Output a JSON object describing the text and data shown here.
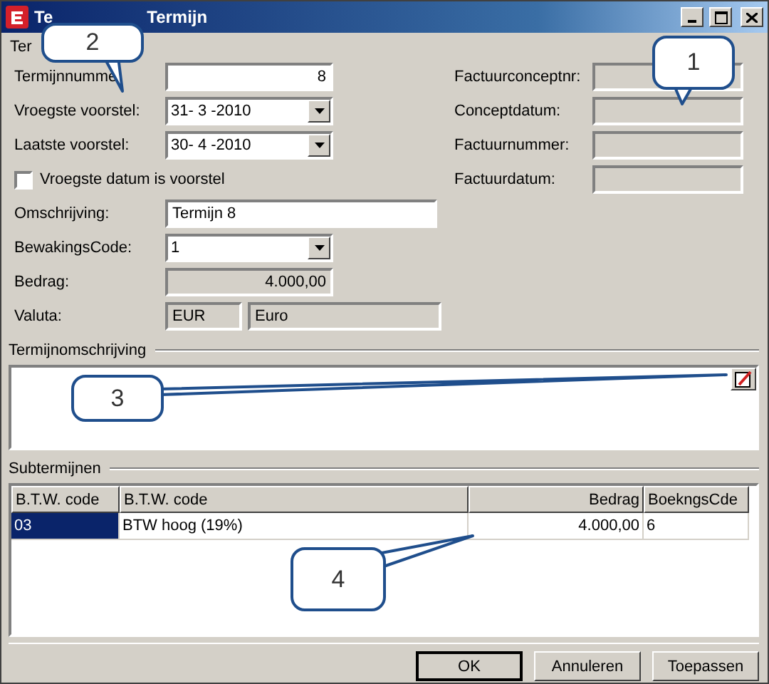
{
  "window": {
    "title_start": "Te",
    "title_end": "Termijn"
  },
  "group_label": "Ter",
  "left_fields": [
    {
      "label": "Termijnnumme",
      "kind": "number",
      "value": "8",
      "disabled": false
    },
    {
      "label": "Vroegste voorstel:",
      "kind": "combo",
      "value": "31- 3 -2010",
      "disabled": false
    },
    {
      "label": "Laatste voorstel:",
      "kind": "combo",
      "value": "30- 4 -2010",
      "disabled": false
    },
    {
      "label": "Vroegste datum is voorstel",
      "kind": "checkbox",
      "checked": false
    },
    {
      "label": "Omschrijving:",
      "kind": "wide",
      "value": "Termijn 8",
      "disabled": false
    },
    {
      "label": "BewakingsCode:",
      "kind": "combo",
      "value": "1",
      "disabled": false
    },
    {
      "label": "Bedrag:",
      "kind": "number",
      "value": "4.000,00",
      "disabled": true
    },
    {
      "label": "Valuta:",
      "kind": "pair",
      "value": "EUR",
      "value2": "Euro",
      "disabled": true
    }
  ],
  "right_fields": [
    {
      "label": "Factuurconceptnr:"
    },
    {
      "label": "Conceptdatum:"
    },
    {
      "label": "Factuurnummer:"
    },
    {
      "label": "Factuurdatum:"
    }
  ],
  "description_section": {
    "title": "Termijnomschrijving"
  },
  "subterms_section": {
    "title": "Subtermijnen",
    "table": {
      "columns": [
        "B.T.W. code",
        "B.T.W. code",
        "Bedrag",
        "BoekngsCde"
      ],
      "rows": [
        {
          "selected": true,
          "cells": [
            "03",
            "BTW hoog (19%)",
            "4.000,00",
            "6"
          ]
        }
      ]
    }
  },
  "buttons": [
    {
      "label": "OK",
      "default": true
    },
    {
      "label": "Annuleren",
      "default": false
    },
    {
      "label": "Toepassen",
      "default": false
    }
  ],
  "callouts": [
    {
      "number": "1"
    },
    {
      "number": "2"
    },
    {
      "number": "3"
    },
    {
      "number": "4"
    }
  ]
}
